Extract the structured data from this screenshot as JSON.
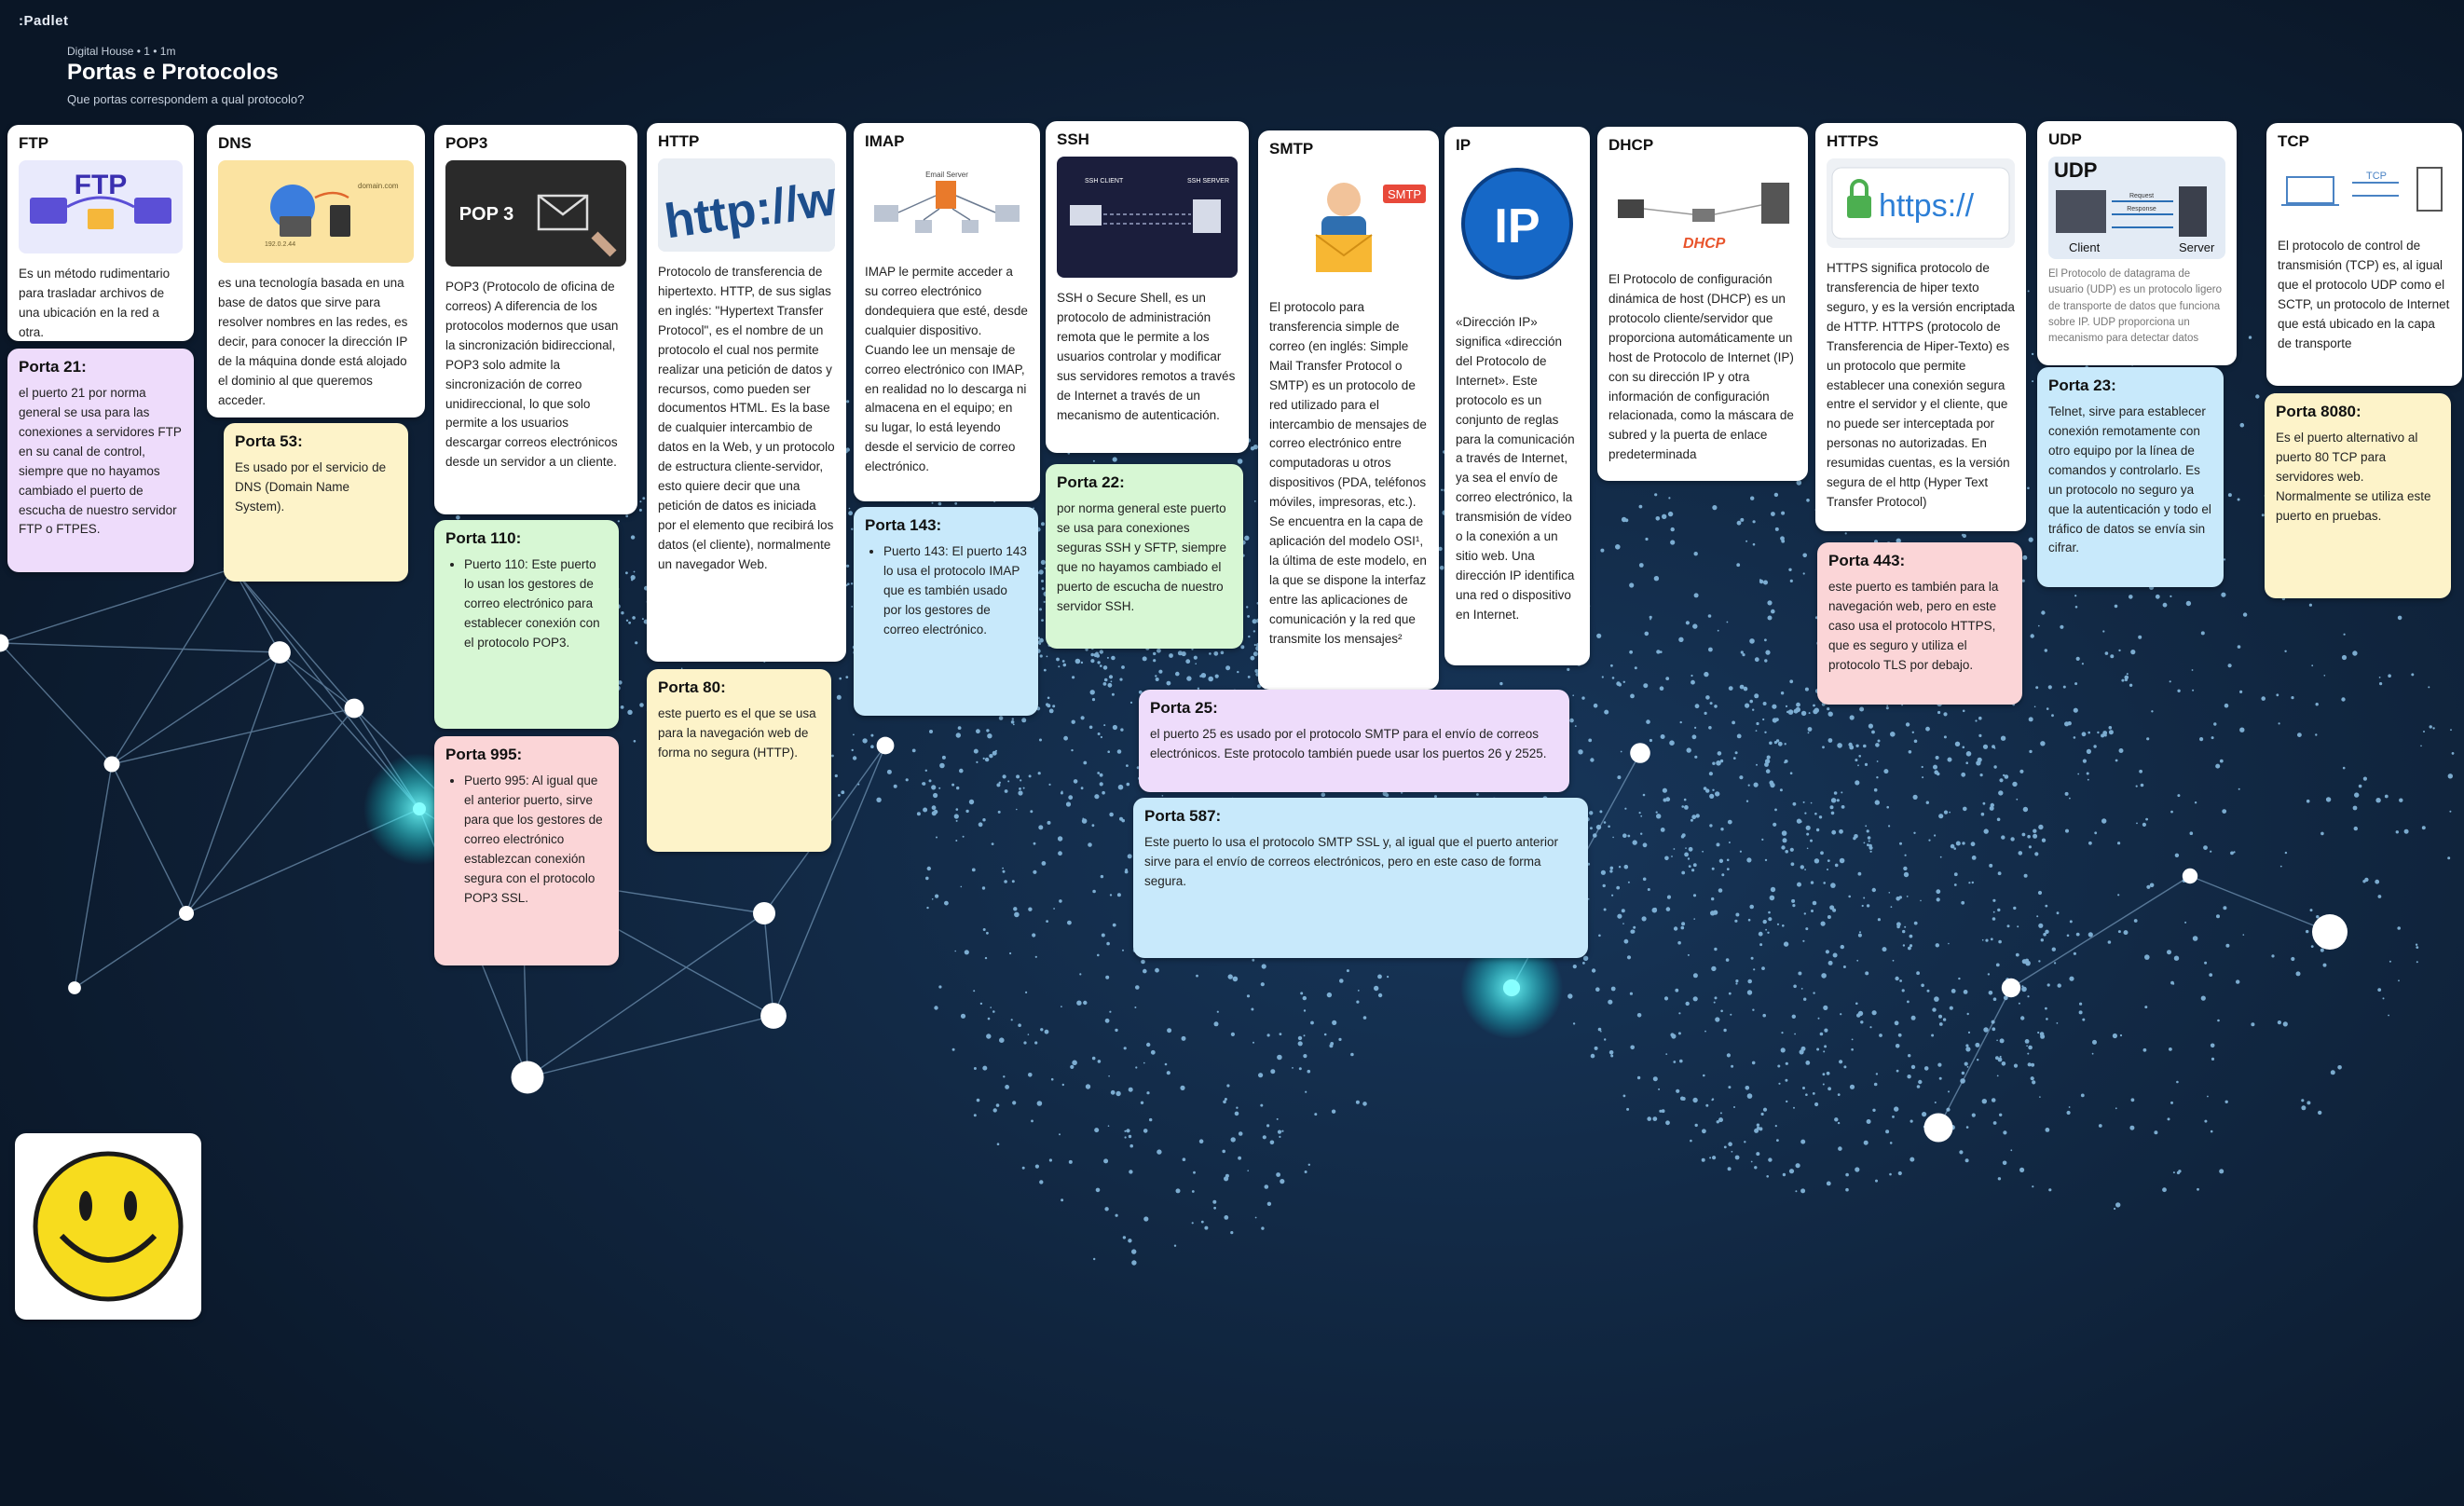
{
  "app": {
    "logo": ":Padlet"
  },
  "header": {
    "meta": "Digital House • 1 • 1m",
    "title": "Portas e Protocolos",
    "subtitle": "Que portas correspondem a qual protocolo?"
  },
  "columns": {
    "ftp": {
      "title": "FTP",
      "image_text": "FTP",
      "body": "Es un método rudimentario para trasladar archivos de una ubicación en la red a otra.",
      "port_title": "Porta 21:",
      "port_body": "el puerto 21 por norma general se usa para las conexiones a servidores FTP en su canal de control, siempre que no hayamos cambiado el puerto de escucha de nuestro servidor FTP o FTPES."
    },
    "dns": {
      "title": "DNS",
      "image_label_a": "domain.com",
      "image_label_b": "192.0.2.44",
      "body": "es una tecnología basada en una base de datos que sirve para resolver nombres en las redes, es decir, para conocer la dirección IP de la máquina donde está alojado el dominio al que queremos acceder.",
      "port_title": "Porta 53:",
      "port_body": "Es usado por el servicio de DNS (Domain Name System)."
    },
    "pop3": {
      "title": "POP3",
      "image_text": "POP 3",
      "body": "POP3 (Protocolo de oficina de correos) A diferencia de los protocolos modernos que usan la sincronización bidireccional, POP3 solo admite la sincronización de correo unidireccional, lo que solo permite a los usuarios descargar correos electrónicos desde un servidor a un cliente.",
      "port110_title": "Porta 110:",
      "port110_body": "Puerto 110: Este puerto lo usan los gestores de correo electrónico para establecer conexión con el protocolo POP3.",
      "port995_title": "Porta 995:",
      "port995_body": "Puerto 995: Al igual que el anterior puerto, sirve para que los gestores de correo electrónico establezcan conexión segura con el protocolo POP3 SSL."
    },
    "http": {
      "title": "HTTP",
      "image_text": "http://ww",
      "body": "Protocolo de transferencia de hipertexto. HTTP, de sus siglas en inglés: \"Hypertext Transfer Protocol\", es el nombre de un protocolo el cual nos permite realizar una petición de datos y recursos, como pueden ser documentos HTML. Es la base de cualquier intercambio de datos en la Web, y un protocolo de estructura cliente-servidor, esto quiere decir que una petición de datos es iniciada por el elemento que recibirá los datos (el cliente), normalmente un navegador Web.",
      "port_title": "Porta 80:",
      "port_body": "este puerto es el que se usa para la navegación web de forma no segura (HTTP)."
    },
    "imap": {
      "title": "IMAP",
      "image_label": "Email Server",
      "body": "IMAP le permite acceder a su correo electrónico dondequiera que esté, desde cualquier dispositivo. Cuando lee un mensaje de correo electrónico con IMAP, en realidad no lo descarga ni almacena en el equipo; en su lugar, lo está leyendo desde el servicio de correo electrónico.",
      "port_title": "Porta 143:",
      "port_body": "Puerto 143: El puerto 143 lo usa el protocolo IMAP que es también usado por los gestores de correo electrónico."
    },
    "ssh": {
      "title": "SSH",
      "image_label_a": "SSH CLIENT",
      "image_label_b": "SSH SERVER",
      "body": "SSH o Secure Shell, es un protocolo de administración remota que le permite a los usuarios controlar y modificar sus servidores remotos a través de Internet a través de un mecanismo de autenticación.",
      "port_title": "Porta 22:",
      "port_body": "por norma general este puerto se usa para conexiones seguras SSH y SFTP, siempre que no hayamos cambiado el puerto de escucha de nuestro servidor SSH."
    },
    "smtp": {
      "title": "SMTP",
      "image_text": "SMTP",
      "body": "El protocolo para transferencia simple de correo (en inglés: Simple Mail Transfer Protocol o SMTP) es un protocolo de red utilizado para el intercambio de mensajes de correo electrónico entre computadoras u otros dispositivos (PDA, teléfonos móviles, impresoras, etc.). Se encuentra en la capa de aplicación del modelo OSI¹, la última de este modelo, en la que se dispone la interfaz entre las aplicaciones de comunicación y la red que transmite los mensajes²",
      "port25_title": "Porta 25:",
      "port25_body": "el puerto 25 es usado por el protocolo SMTP para el envío de correos electrónicos. Este protocolo también puede usar los puertos 26 y 2525.",
      "port587_title": "Porta 587:",
      "port587_body": "Este puerto lo usa el protocolo SMTP SSL y, al igual que el puerto anterior sirve para el envío de correos electrónicos, pero en este caso de forma segura."
    },
    "ip": {
      "title": "IP",
      "image_text": "IP",
      "body": "«Dirección IP» significa «dirección del Protocolo de Internet». Este protocolo es un conjunto de reglas para la comunicación a través de Internet, ya sea el envío de correo electrónico, la transmisión de vídeo o la conexión a un sitio web. Una dirección IP identifica una red o dispositivo en Internet."
    },
    "dhcp": {
      "title": "DHCP",
      "image_text": "DHCP",
      "body": "El Protocolo de configuración dinámica de host (DHCP) es un protocolo cliente/servidor que proporciona automáticamente un host de Protocolo de Internet (IP) con su dirección IP y otra información de configuración relacionada, como la máscara de subred y la puerta de enlace predeterminada"
    },
    "https": {
      "title": "HTTPS",
      "image_text": "https://",
      "body": "HTTPS significa protocolo de transferencia de hiper texto seguro, y es la versión encriptada de HTTP. HTTPS (protocolo de Transferencia de Hiper-Texto) es un protocolo que permite establecer una conexión segura entre el servidor y el cliente, que no puede ser interceptada por personas no autorizadas. En resumidas cuentas, es la versión segura de el http (Hyper Text Transfer Protocol)",
      "port_title": "Porta 443:",
      "port_body": "este puerto es también para la navegación web, pero en este caso usa el protocolo HTTPS, que es seguro y utiliza el protocolo TLS por debajo."
    },
    "udp": {
      "title": "UDP",
      "image_text": "UDP",
      "image_client": "Client",
      "image_server": "Server",
      "image_req": "Request",
      "image_resp": "Response",
      "body": "El Protocolo de datagrama de usuario (UDP) es un protocolo ligero de transporte de datos que funciona sobre IP. UDP proporciona un mecanismo para detectar datos",
      "port_title": "Porta 23:",
      "port_body": "Telnet, sirve para establecer conexión remotamente con otro equipo por la línea de comandos y controlarlo. Es un protocolo no seguro ya que la autenticación y todo el tráfico de datos se envía sin cifrar."
    },
    "tcp": {
      "title": "TCP",
      "image_text": "TCP",
      "body": "El protocolo de control de transmisión (TCP) es, al igual que el protocolo UDP como el SCTP, un protocolo de Internet que está ubicado en la capa de transporte",
      "port_title": "Porta 8080:",
      "port_body": "Es el puerto alternativo al puerto 80 TCP para servidores web. Normalmente se utiliza este puerto en pruebas."
    }
  },
  "colors": {
    "background": "#0d1b2e",
    "purple_note": "#eedcfb",
    "yellow_note": "#fdf3c9",
    "green_note": "#d7f7d4",
    "blue_note": "#c8e9fb",
    "pink_note": "#fbd5d7",
    "smiley": "#f7dc1e"
  }
}
